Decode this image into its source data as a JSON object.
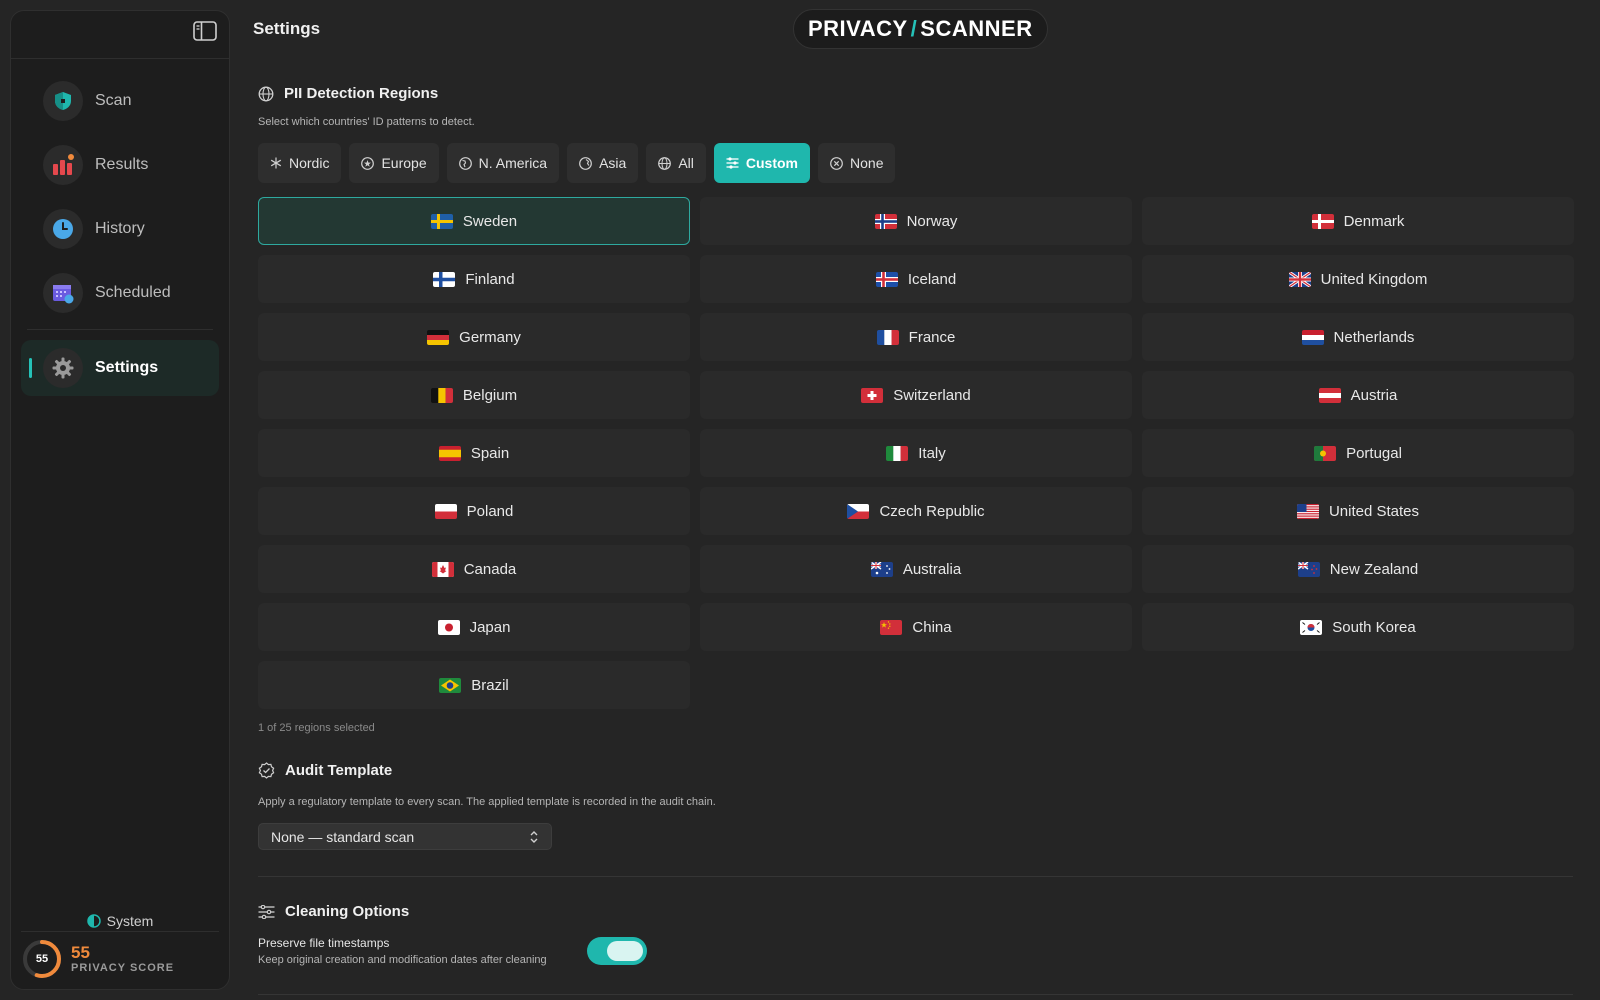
{
  "header": {
    "title": "Settings"
  },
  "brand": {
    "left": "PRIVACY",
    "slash": "/",
    "right": "SCANNER"
  },
  "sidebar": {
    "items": [
      {
        "label": "Scan"
      },
      {
        "label": "Results"
      },
      {
        "label": "History"
      },
      {
        "label": "Scheduled"
      },
      {
        "label": "Settings"
      }
    ],
    "theme_label": "System",
    "score": {
      "value": "55",
      "ring_value": "55",
      "label": "PRIVACY SCORE",
      "fraction": 0.55
    }
  },
  "pii": {
    "title": "PII Detection Regions",
    "description": "Select which countries' ID patterns to detect.",
    "presets": [
      {
        "label": "Nordic"
      },
      {
        "label": "Europe"
      },
      {
        "label": "N. America"
      },
      {
        "label": "Asia"
      },
      {
        "label": "All"
      },
      {
        "label": "Custom"
      },
      {
        "label": "None"
      }
    ],
    "regions": [
      {
        "name": "Sweden"
      },
      {
        "name": "Norway"
      },
      {
        "name": "Denmark"
      },
      {
        "name": "Finland"
      },
      {
        "name": "Iceland"
      },
      {
        "name": "United Kingdom"
      },
      {
        "name": "Germany"
      },
      {
        "name": "France"
      },
      {
        "name": "Netherlands"
      },
      {
        "name": "Belgium"
      },
      {
        "name": "Switzerland"
      },
      {
        "name": "Austria"
      },
      {
        "name": "Spain"
      },
      {
        "name": "Italy"
      },
      {
        "name": "Portugal"
      },
      {
        "name": "Poland"
      },
      {
        "name": "Czech Republic"
      },
      {
        "name": "United States"
      },
      {
        "name": "Canada"
      },
      {
        "name": "Australia"
      },
      {
        "name": "New Zealand"
      },
      {
        "name": "Japan"
      },
      {
        "name": "China"
      },
      {
        "name": "South Korea"
      },
      {
        "name": "Brazil"
      }
    ],
    "count_text": "1 of 25 regions selected"
  },
  "audit": {
    "title": "Audit Template",
    "description": "Apply a regulatory template to every scan. The applied template is recorded in the audit chain.",
    "selected": "None — standard scan"
  },
  "cleaning": {
    "title": "Cleaning Options",
    "option_title": "Preserve file timestamps",
    "option_desc": "Keep original creation and modification dates after cleaning",
    "enabled": true
  },
  "colors": {
    "accent": "#1fb7ad",
    "score": "#f08a3c",
    "background": "#252525",
    "sidebar": "#1d1d1d"
  }
}
